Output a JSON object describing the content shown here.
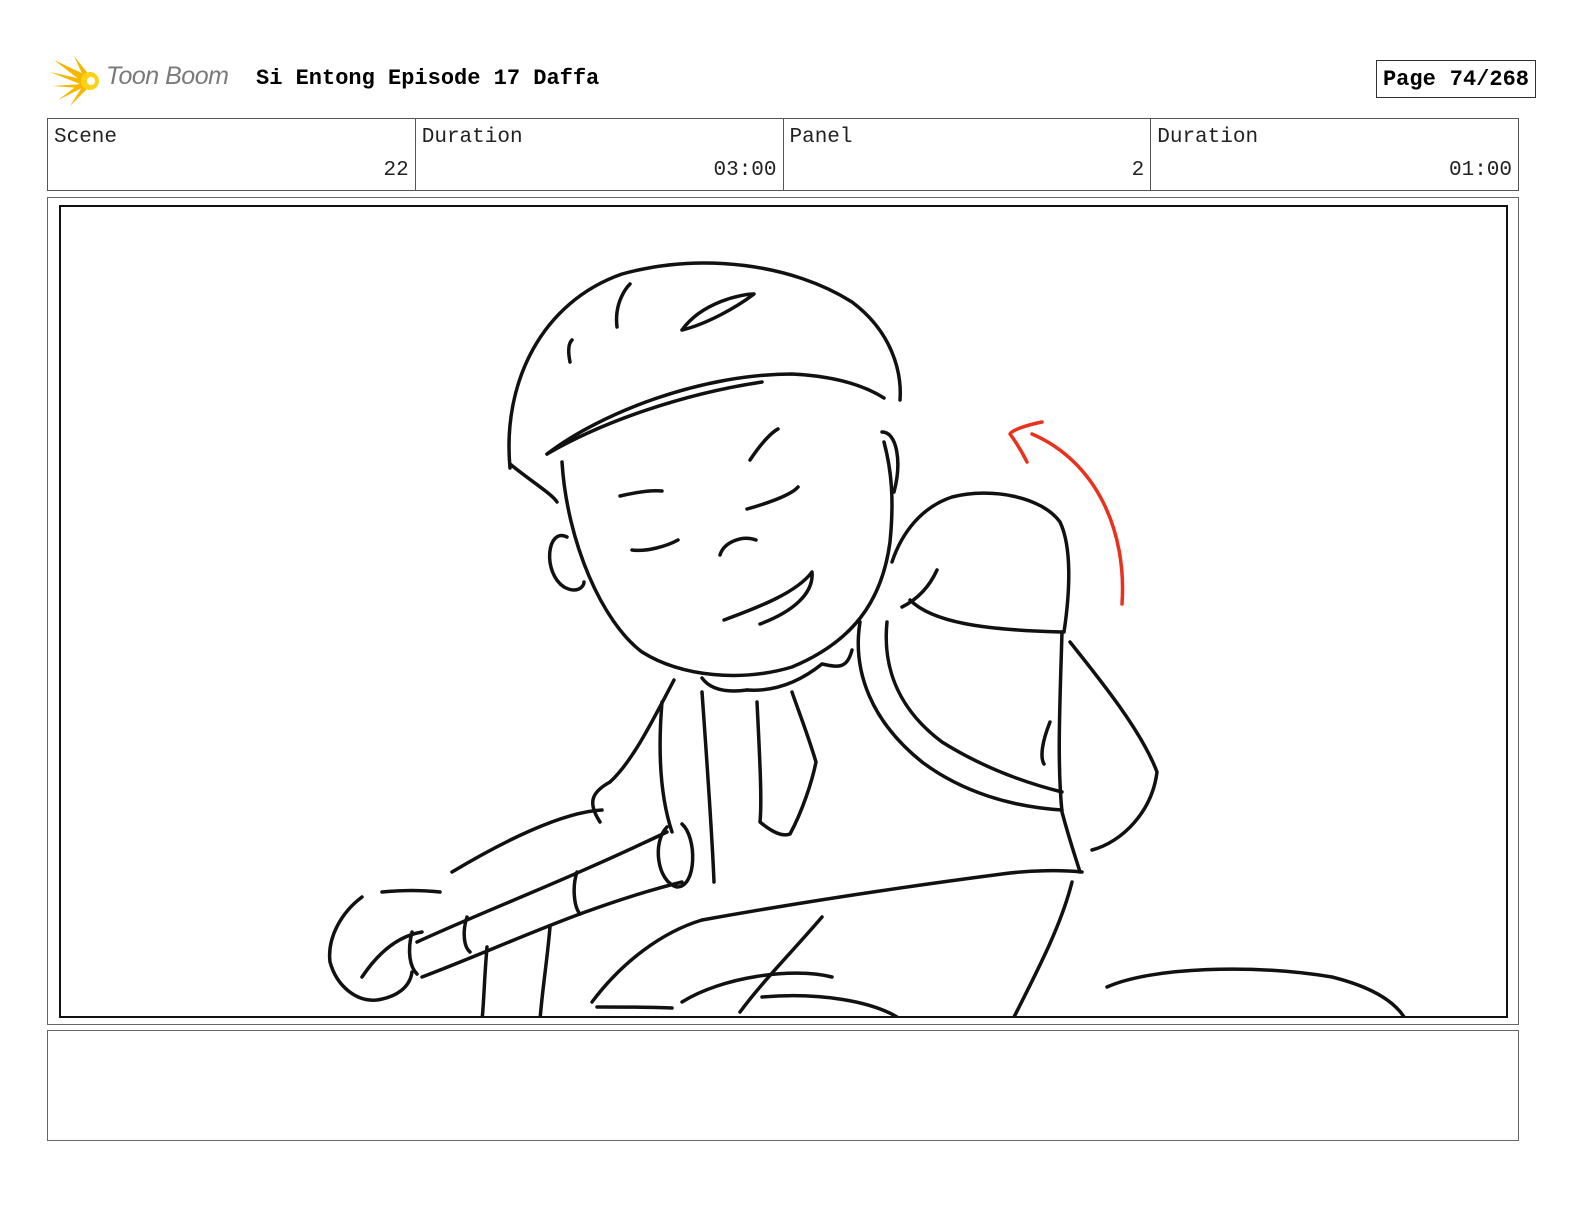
{
  "header": {
    "logo_text": "Toon Boom",
    "title": "Si Entong Episode 17 Daffa",
    "page_label": "Page",
    "page_value": "74/268"
  },
  "info": [
    {
      "label": "Scene",
      "value": "22"
    },
    {
      "label": "Duration",
      "value": "03:00"
    },
    {
      "label": "Panel",
      "value": "2"
    },
    {
      "label": "Duration",
      "value": "01:00"
    }
  ],
  "colors": {
    "logo_accent": "#f5b700",
    "motion_arrow": "#e8321c",
    "logo_text": "#7a7a7a"
  },
  "notes": ""
}
